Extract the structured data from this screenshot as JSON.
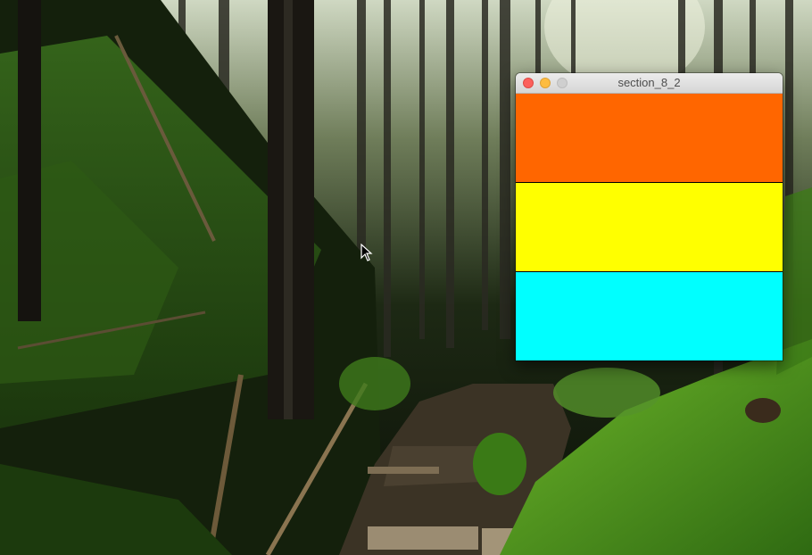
{
  "window": {
    "title": "section_8_2",
    "close_icon": "close-icon",
    "minimize_icon": "minimize-icon",
    "zoom_icon": "zoom-icon"
  },
  "bands": [
    {
      "name": "orange",
      "color": "#ff6600"
    },
    {
      "name": "yellow",
      "color": "#ffff00"
    },
    {
      "name": "cyan",
      "color": "#00ffff"
    }
  ],
  "cursor_icon": "arrow-cursor-icon"
}
